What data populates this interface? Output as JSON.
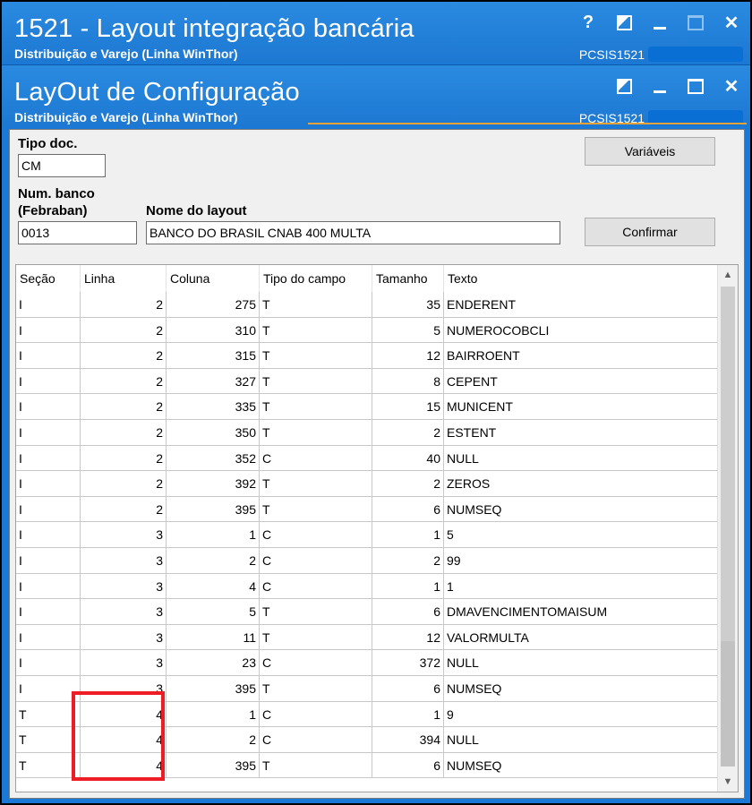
{
  "window1": {
    "title": "1521 - Layout integração bancária",
    "subtitle": "Distribuição e Varejo (Linha WinThor)",
    "code": "PCSIS1521",
    "help_label": "?"
  },
  "window2": {
    "title": "LayOut de Configuração",
    "subtitle": "Distribuição e Varejo (Linha WinThor)",
    "code": "PCSIS1521"
  },
  "form": {
    "tipo_doc_label": "Tipo doc.",
    "tipo_doc_value": "CM",
    "num_banco_label1": "Num. banco",
    "num_banco_label2": "(Febraban)",
    "num_banco_value": "0013",
    "nome_layout_label": "Nome do layout",
    "nome_layout_value": "BANCO DO BRASIL CNAB 400  MULTA",
    "variaveis_label": "Variáveis",
    "confirmar_label": "Confirmar"
  },
  "grid": {
    "columns": [
      "Seção",
      "Linha",
      "Coluna",
      "Tipo do campo",
      "Tamanho",
      "Texto"
    ],
    "rows": [
      [
        "I",
        "2",
        "275",
        "T",
        "35",
        "ENDERENT"
      ],
      [
        "I",
        "2",
        "310",
        "T",
        "5",
        "NUMEROCOBCLI"
      ],
      [
        "I",
        "2",
        "315",
        "T",
        "12",
        "BAIRROENT"
      ],
      [
        "I",
        "2",
        "327",
        "T",
        "8",
        "CEPENT"
      ],
      [
        "I",
        "2",
        "335",
        "T",
        "15",
        "MUNICENT"
      ],
      [
        "I",
        "2",
        "350",
        "T",
        "2",
        "ESTENT"
      ],
      [
        "I",
        "2",
        "352",
        "C",
        "40",
        "NULL"
      ],
      [
        "I",
        "2",
        "392",
        "T",
        "2",
        "ZEROS"
      ],
      [
        "I",
        "2",
        "395",
        "T",
        "6",
        "NUMSEQ"
      ],
      [
        "I",
        "3",
        "1",
        "C",
        "1",
        "5"
      ],
      [
        "I",
        "3",
        "2",
        "C",
        "2",
        "99"
      ],
      [
        "I",
        "3",
        "4",
        "C",
        "1",
        "1"
      ],
      [
        "I",
        "3",
        "5",
        "T",
        "6",
        "DMAVENCIMENTOMAISUM"
      ],
      [
        "I",
        "3",
        "11",
        "T",
        "12",
        "VALORMULTA"
      ],
      [
        "I",
        "3",
        "23",
        "C",
        "372",
        "NULL"
      ],
      [
        "I",
        "3",
        "395",
        "T",
        "6",
        "NUMSEQ"
      ],
      [
        "T",
        "4",
        "1",
        "C",
        "1",
        "9"
      ],
      [
        "T",
        "4",
        "2",
        "C",
        "394",
        "NULL"
      ],
      [
        "T",
        "4",
        "395",
        "T",
        "6",
        "NUMSEQ"
      ]
    ]
  },
  "colors": {
    "titlebar": "#1d78d2",
    "accent_line": "#e8a23a",
    "highlight": "#ee1c25"
  }
}
